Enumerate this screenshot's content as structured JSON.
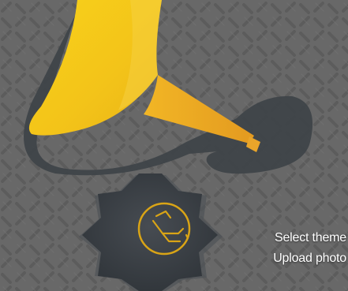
{
  "colors": {
    "background": "#686868",
    "funnel_yellow": "#f5c518",
    "funnel_orange": "#e8a020",
    "badge_dark": "#3b4045",
    "accent": "#d9a416",
    "menu_text": "#ffffff"
  },
  "menu": {
    "select_theme": "Select theme",
    "upload_photo": "Upload photo"
  },
  "icons": {
    "badge": "oil-can-icon",
    "funnel": "funnel-icon"
  }
}
